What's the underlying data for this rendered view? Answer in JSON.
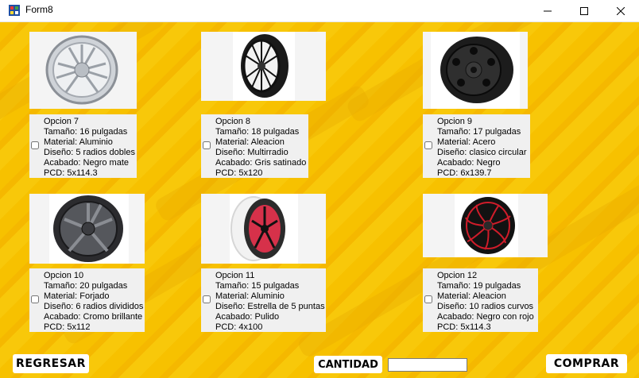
{
  "window": {
    "title": "Form8",
    "minimize": "–",
    "maximize": "□",
    "close": "✕"
  },
  "options": [
    {
      "name": "Opcion 7",
      "size": "Tamaño: 16 pulgadas",
      "material": "Material: Aluminio",
      "design": "Diseño: 5 radios dobles",
      "finish": "Acabado: Negro mate",
      "pcd": "PCD: 5x114.3",
      "checked": false,
      "icon": "chrome-wheel-icon"
    },
    {
      "name": "Opcion 8",
      "size": "Tamaño: 18 pulgadas",
      "material": "Material: Aleacion",
      "design": "Diseño: Multirradio",
      "finish": "Acabado: Gris satinado",
      "pcd": "PCD: 5x120",
      "checked": false,
      "icon": "black-multispoke-wheel-icon"
    },
    {
      "name": "Opcion 9",
      "size": "Tamaño: 17 pulgadas",
      "material": "Material: Acero",
      "design": "Diseño: clasico circular",
      "finish": "Acabado: Negro",
      "pcd": "PCD: 6x139.7",
      "checked": false,
      "icon": "steel-wheel-icon"
    },
    {
      "name": "Opcion 10",
      "size": "Tamaño: 20 pulgadas",
      "material": "Material: Forjado",
      "design": "Diseño: 6 radios divididos",
      "finish": "Acabado: Cromo brillante",
      "pcd": "PCD: 5x112",
      "checked": false,
      "icon": "gunmetal-wheel-icon"
    },
    {
      "name": "Opcion 11",
      "size": "Tamaño: 15 pulgadas",
      "material": "Material: Aluminio",
      "design": "Diseño: Estrella de 5 puntas",
      "finish": "Acabado: Pulido",
      "pcd": "PCD: 4x100",
      "checked": false,
      "icon": "red-white-wheel-icon"
    },
    {
      "name": "Opcion 12",
      "size": "Tamaño: 19 pulgadas",
      "material": "Material: Aleacion",
      "design": "Diseño: 10 radios curvos",
      "finish": "Acabado: Negro con rojo",
      "pcd": "PCD: 5x114.3",
      "checked": false,
      "icon": "black-red-wheel-icon"
    }
  ],
  "footer": {
    "back_label": "REGRESAR",
    "quantity_label": "CANTIDAD",
    "quantity_value": "",
    "buy_label": "COMPRAR"
  },
  "colors": {
    "background": "#f7c100",
    "panel": "#f0f0f0"
  }
}
